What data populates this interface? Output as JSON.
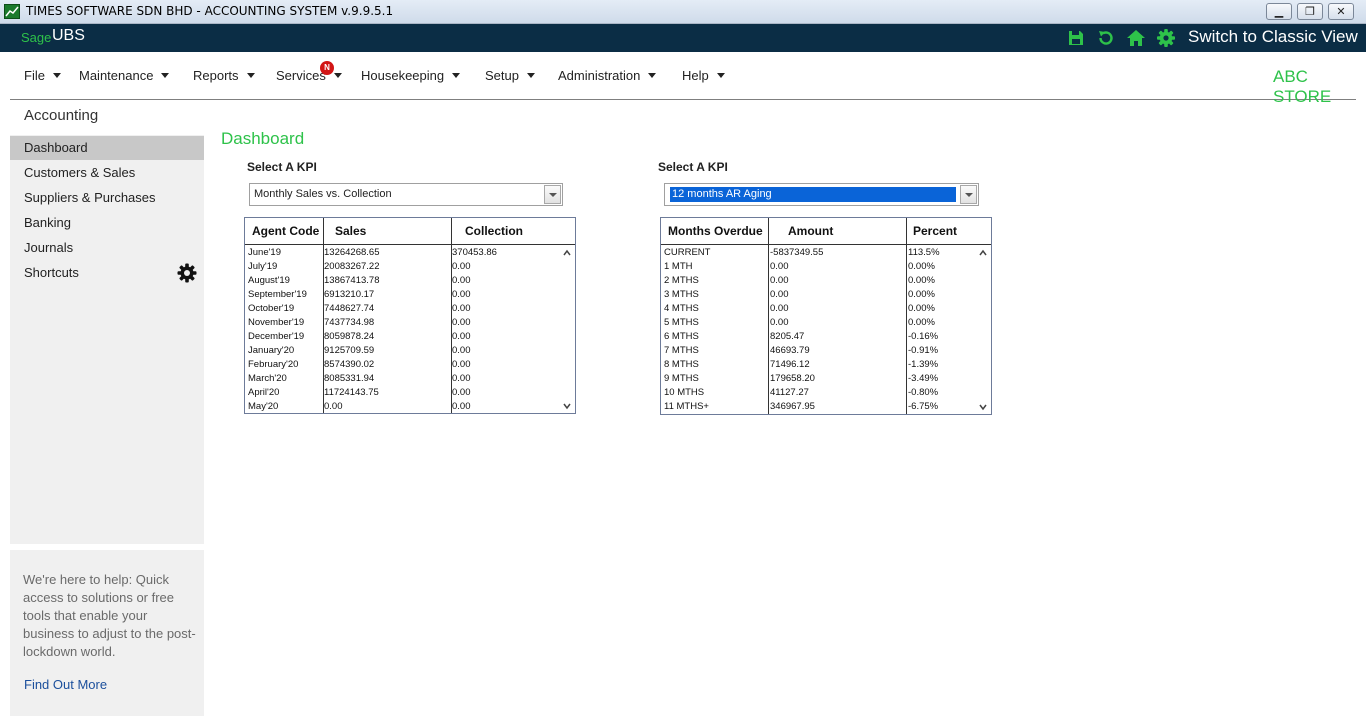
{
  "window": {
    "title": "TIMES SOFTWARE SDN BHD - ACCOUNTING SYSTEM v.9.9.5.1",
    "min_glyph": "▁",
    "max_glyph": "❐",
    "close_glyph": "✕"
  },
  "header": {
    "brand_sage": "Sage",
    "brand_ubs": "UBS",
    "classic_view": "Switch to Classic View",
    "accent_color": "#2ec24a",
    "icons": [
      "save-icon",
      "refresh-icon",
      "home-icon",
      "settings-icon"
    ]
  },
  "menu": {
    "items": [
      {
        "label": "File"
      },
      {
        "label": "Maintenance"
      },
      {
        "label": "Reports"
      },
      {
        "label": "Services"
      },
      {
        "label": "Housekeeping"
      },
      {
        "label": "Setup"
      },
      {
        "label": "Administration"
      },
      {
        "label": "Help"
      }
    ],
    "services_badge": "N",
    "store_name": "ABC STORE"
  },
  "sidebar": {
    "section_title": "Accounting",
    "items": [
      {
        "label": "Dashboard"
      },
      {
        "label": "Customers & Sales"
      },
      {
        "label": "Suppliers & Purchases"
      },
      {
        "label": "Banking"
      },
      {
        "label": "Journals"
      },
      {
        "label": "Shortcuts"
      }
    ],
    "active_item": "Dashboard",
    "help_text": "We're here to help: Quick access to solutions or free tools that enable your business to adjust to the post-lockdown world.",
    "help_link": "Find Out More"
  },
  "dashboard": {
    "title": "Dashboard",
    "left": {
      "kpi_label": "Select A KPI",
      "selected": "Monthly Sales vs. Collection",
      "columns": [
        "Agent Code",
        "Sales",
        "Collection"
      ],
      "rows": [
        [
          "June'19",
          "13264268.65",
          "370453.86"
        ],
        [
          "July'19",
          "20083267.22",
          "0.00"
        ],
        [
          "August'19",
          "13867413.78",
          "0.00"
        ],
        [
          "September'19",
          "6913210.17",
          "0.00"
        ],
        [
          "October'19",
          "7448627.74",
          "0.00"
        ],
        [
          "November'19",
          "7437734.98",
          "0.00"
        ],
        [
          "December'19",
          "8059878.24",
          "0.00"
        ],
        [
          "January'20",
          "9125709.59",
          "0.00"
        ],
        [
          "February'20",
          "8574390.02",
          "0.00"
        ],
        [
          "March'20",
          "8085331.94",
          "0.00"
        ],
        [
          "April'20",
          "11724143.75",
          "0.00"
        ],
        [
          "May'20",
          "0.00",
          "0.00"
        ]
      ]
    },
    "right": {
      "kpi_label": "Select A KPI",
      "selected": "12 months AR Aging",
      "columns": [
        "Months Overdue",
        "Amount",
        "Percent"
      ],
      "rows": [
        [
          "CURRENT",
          "-5837349.55",
          "113.5%"
        ],
        [
          "1 MTH",
          "0.00",
          "0.00%"
        ],
        [
          "2 MTHS",
          "0.00",
          "0.00%"
        ],
        [
          "3 MTHS",
          "0.00",
          "0.00%"
        ],
        [
          "4 MTHS",
          "0.00",
          "0.00%"
        ],
        [
          "5 MTHS",
          "0.00",
          "0.00%"
        ],
        [
          "6 MTHS",
          "8205.47",
          "-0.16%"
        ],
        [
          "7 MTHS",
          "46693.79",
          "-0.91%"
        ],
        [
          "8 MTHS",
          "71496.12",
          "-1.39%"
        ],
        [
          "9 MTHS",
          "179658.20",
          "-3.49%"
        ],
        [
          "10 MTHS",
          "41127.27",
          "-0.80%"
        ],
        [
          "11 MTHS+",
          "346967.95",
          "-6.75%"
        ]
      ]
    }
  }
}
